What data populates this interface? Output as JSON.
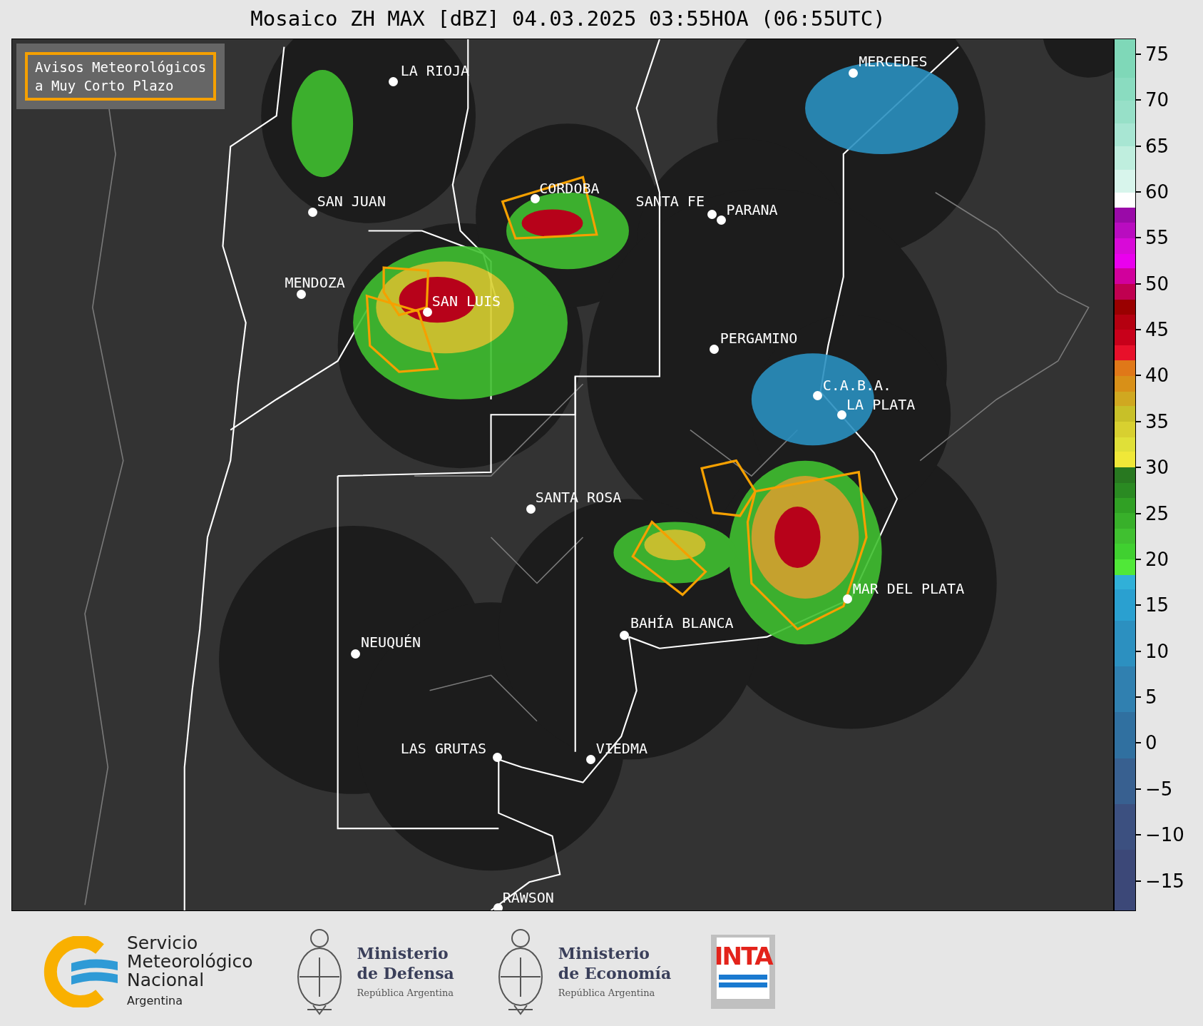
{
  "title": "Mosaico ZH MAX [dBZ] 04.03.2025 03:55HOA (06:55UTC)",
  "legend": {
    "lines": [
      "Avisos Meteorológicos",
      "a Muy Corto Plazo"
    ]
  },
  "cities": [
    {
      "name": "MERCEDES"
    },
    {
      "name": "LA RIOJA"
    },
    {
      "name": "CORDOBA"
    },
    {
      "name": "SAN JUAN"
    },
    {
      "name": "SANTA FE"
    },
    {
      "name": "PARANA"
    },
    {
      "name": "MENDOZA"
    },
    {
      "name": "SAN LUIS"
    },
    {
      "name": "PERGAMINO"
    },
    {
      "name": "C.A.B.A."
    },
    {
      "name": "LA PLATA"
    },
    {
      "name": "SANTA ROSA"
    },
    {
      "name": "MAR DEL PLATA"
    },
    {
      "name": "BAHÍA BLANCA"
    },
    {
      "name": "NEUQUÉN"
    },
    {
      "name": "LAS GRUTAS"
    },
    {
      "name": "VIEDMA"
    },
    {
      "name": "RAWSON"
    }
  ],
  "colorbar": {
    "ticks": [
      "75",
      "70",
      "65",
      "60",
      "55",
      "50",
      "45",
      "40",
      "35",
      "30",
      "25",
      "20",
      "15",
      "10",
      "5",
      "0",
      "−5",
      "−10",
      "−15"
    ]
  },
  "footer": {
    "logos": [
      {
        "kind": "smn",
        "lines": [
          "Servicio",
          "Meteorológico",
          "Nacional"
        ],
        "subtitle": "Argentina"
      },
      {
        "kind": "ministry",
        "lines": [
          "Ministerio",
          "de Defensa"
        ],
        "subtitle": "República Argentina"
      },
      {
        "kind": "ministry",
        "lines": [
          "Ministerio",
          "de Economía"
        ],
        "subtitle": "República Argentina"
      },
      {
        "kind": "inta",
        "lines": [
          "INTA"
        ]
      }
    ]
  }
}
